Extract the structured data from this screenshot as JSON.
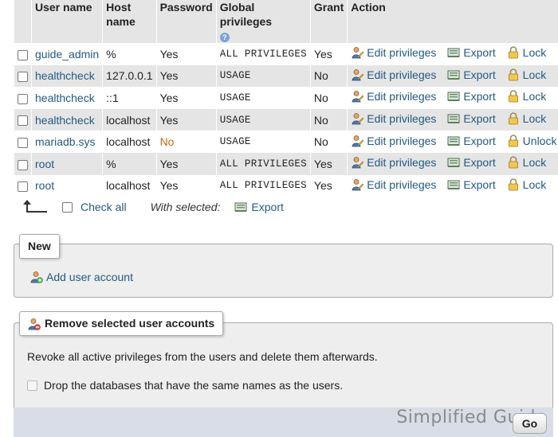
{
  "table": {
    "headers": {
      "user_name": "User name",
      "host_name": "Host name",
      "password": "Password",
      "global_privileges": "Global privileges",
      "grant": "Grant",
      "action": "Action"
    },
    "rows": [
      {
        "user": "guide_admin",
        "host": "%",
        "password": "Yes",
        "privileges": "ALL PRIVILEGES",
        "grant": "Yes",
        "edit": "Edit privileges",
        "export": "Export",
        "lock": "Lock"
      },
      {
        "user": "healthcheck",
        "host": "127.0.0.1",
        "password": "Yes",
        "privileges": "USAGE",
        "grant": "No",
        "edit": "Edit privileges",
        "export": "Export",
        "lock": "Lock"
      },
      {
        "user": "healthcheck",
        "host": "::1",
        "password": "Yes",
        "privileges": "USAGE",
        "grant": "No",
        "edit": "Edit privileges",
        "export": "Export",
        "lock": "Lock"
      },
      {
        "user": "healthcheck",
        "host": "localhost",
        "password": "Yes",
        "privileges": "USAGE",
        "grant": "No",
        "edit": "Edit privileges",
        "export": "Export",
        "lock": "Lock"
      },
      {
        "user": "mariadb.sys",
        "host": "localhost",
        "password": "No",
        "privileges": "USAGE",
        "grant": "No",
        "edit": "Edit privileges",
        "export": "Export",
        "lock": "Unlock"
      },
      {
        "user": "root",
        "host": "%",
        "password": "Yes",
        "privileges": "ALL PRIVILEGES",
        "grant": "Yes",
        "edit": "Edit privileges",
        "export": "Export",
        "lock": "Lock"
      },
      {
        "user": "root",
        "host": "localhost",
        "password": "Yes",
        "privileges": "ALL PRIVILEGES",
        "grant": "Yes",
        "edit": "Edit privileges",
        "export": "Export",
        "lock": "Lock"
      }
    ]
  },
  "bulk": {
    "check_all": "Check all",
    "with_selected": "With selected:",
    "export": "Export"
  },
  "new_section": {
    "legend": "New",
    "add_user": "Add user account"
  },
  "remove_section": {
    "legend": "Remove selected user accounts",
    "description": "Revoke all active privileges from the users and delete them afterwards.",
    "drop_db_label": "Drop the databases that have the same names as the users."
  },
  "footer": {
    "go_button": "Go",
    "watermark": "Simplified Guide"
  },
  "colors": {
    "link": "#235a81",
    "row_shade": "#e5e5e5",
    "password_no": "#cc6600"
  }
}
